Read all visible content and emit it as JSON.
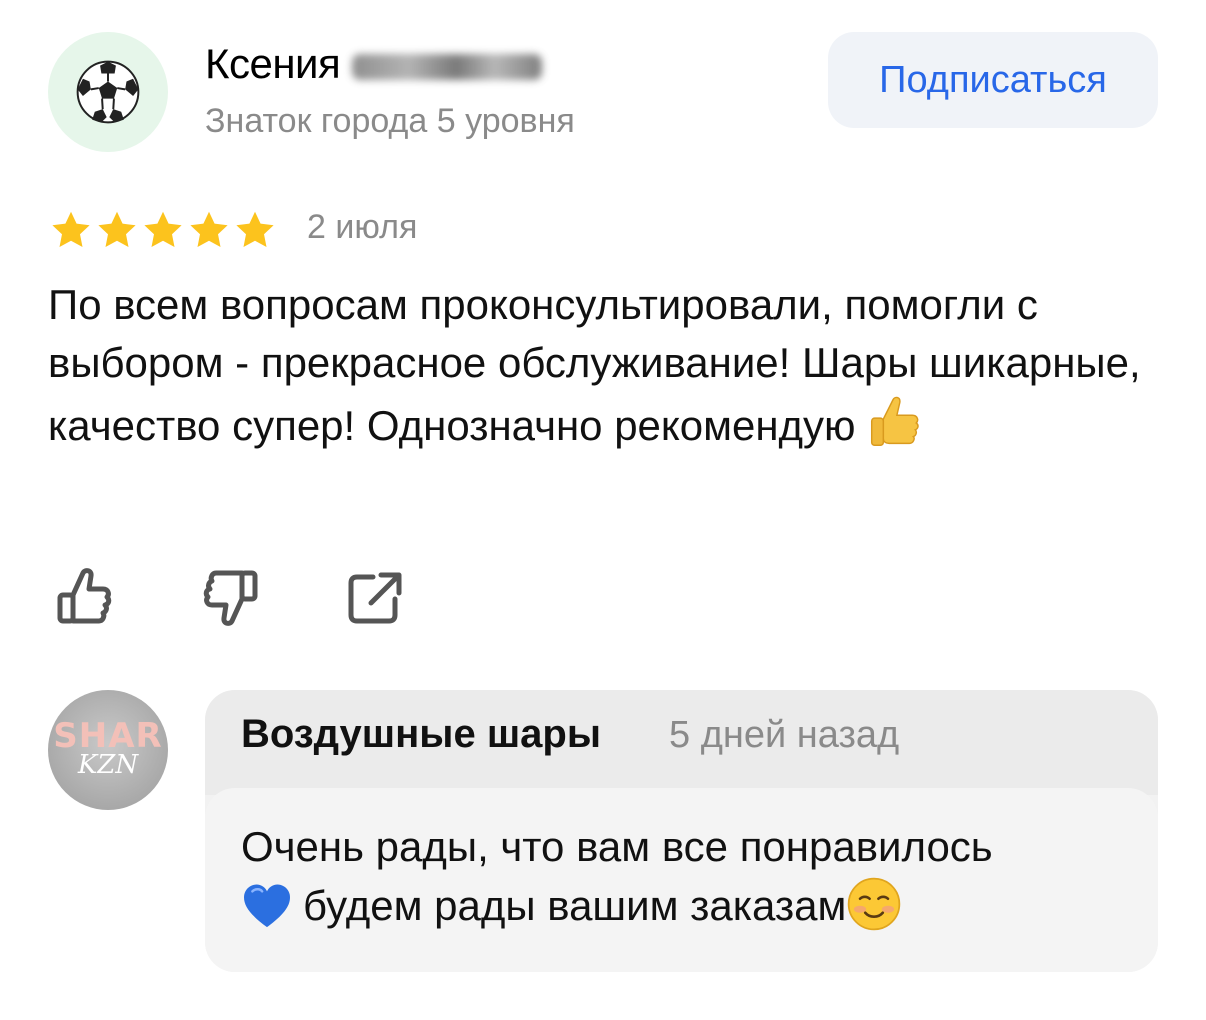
{
  "review": {
    "author_name": "Ксения",
    "author_level": "Знаток города 5 уровня",
    "subscribe_label": "Подписаться",
    "rating": 5,
    "rating_max": 5,
    "date": "2 июля",
    "text": "По всем вопросам проконсультировали, помогли с выбором - прекрасное обслуживание! Шары шикарные, качество супер! Однозначно рекомендую",
    "avatar_icon": "soccer-ball-icon",
    "emoji": "thumbs-up-emoji",
    "actions": [
      "like-icon",
      "dislike-icon",
      "share-icon"
    ]
  },
  "reply": {
    "author": "Воздушные шары",
    "time": "5 дней назад",
    "text_part1": "Очень рады, что вам все понравилось",
    "text_part2": "будем рады вашим заказам",
    "logo_text_top": "SHAR",
    "logo_text_bottom": "KZN",
    "emojis": [
      "blue-heart-emoji",
      "smiling-face-emoji"
    ]
  },
  "colors": {
    "accent": "#2867e8",
    "star": "#fcc31d",
    "muted_text": "#8a8a8a",
    "reply_bg": "#f2f2f2",
    "avatar_bg": "#e6f6ea"
  }
}
